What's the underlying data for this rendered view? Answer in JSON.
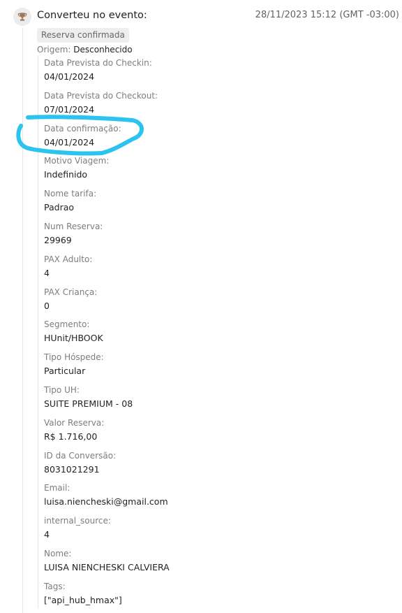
{
  "event": {
    "title": "Converteu no evento:",
    "timestamp": "28/11/2023 15:12 (GMT -03:00)",
    "badge": "Reserva confirmada",
    "origin_label": "Origem:",
    "origin_value": "Desconhecido",
    "icon": "trophy-icon"
  },
  "fields": [
    {
      "label": "Data Prevista do Checkin:",
      "value": "04/01/2024"
    },
    {
      "label": "Data Prevista do Checkout:",
      "value": "07/01/2024"
    },
    {
      "label": "Data confirmação:",
      "value": "04/01/2024"
    },
    {
      "label": "Motivo Viagem:",
      "value": "Indefinido"
    },
    {
      "label": "Nome tarifa:",
      "value": "Padrao"
    },
    {
      "label": "Num Reserva:",
      "value": "29969"
    },
    {
      "label": "PAX Adulto:",
      "value": "4"
    },
    {
      "label": "PAX Criança:",
      "value": "0"
    },
    {
      "label": "Segmento:",
      "value": "HUnit/HBOOK"
    },
    {
      "label": "Tipo Hóspede:",
      "value": "Particular"
    },
    {
      "label": "Tipo UH:",
      "value": "SUITE PREMIUM - 08"
    },
    {
      "label": "Valor Reserva:",
      "value": "R$ 1.716,00"
    },
    {
      "label": "ID da Conversão:",
      "value": "8031021291"
    },
    {
      "label": "Email:",
      "value": "luisa.niencheski@gmail.com"
    },
    {
      "label": "internal_source:",
      "value": "4"
    },
    {
      "label": "Nome:",
      "value": "LUISA NIENCHESKI CALVIERA"
    },
    {
      "label": "Tags:",
      "value": "[\"api_hub_hmax\"]"
    }
  ],
  "colors": {
    "icon": "#a0775a",
    "highlight": "#2cc3ee"
  }
}
